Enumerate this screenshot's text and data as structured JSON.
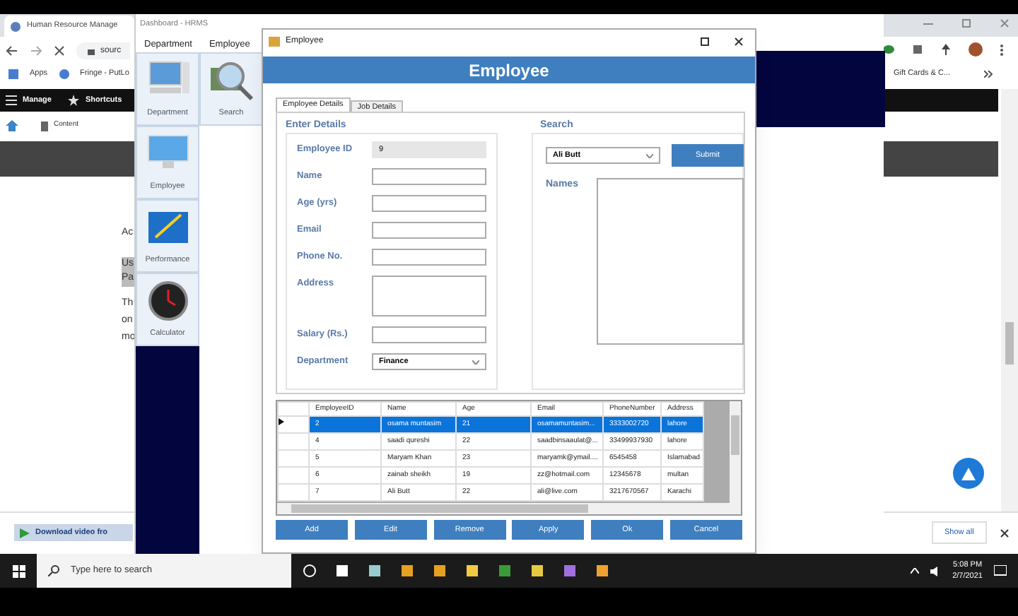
{
  "browser": {
    "tab_title": "Human Resource Manage",
    "address": "sourc",
    "bookmarks": [
      "Apps",
      "Fringe - PutLo",
      "Gift Cards & C..."
    ],
    "toolbar": [
      "Manage",
      "Shortcuts"
    ],
    "breadcrumb": "Content",
    "page_fragments": [
      "Ac",
      "Us",
      "Pa",
      "Th",
      "on",
      "mo"
    ],
    "download": "Download video fro",
    "show_all": "Show all"
  },
  "dashboard": {
    "title": "Dashboard - HRMS",
    "menu": [
      "Department",
      "Employee"
    ],
    "tiles": [
      {
        "kind": "computer",
        "label": "Department"
      },
      {
        "kind": "search",
        "label": "Search"
      },
      {
        "kind": "monitor",
        "label": "Employee"
      },
      {
        "kind": "chart",
        "label": "Performance"
      },
      {
        "kind": "clock",
        "label": "Calculator"
      }
    ]
  },
  "dialog": {
    "title": "Employee",
    "header": "Employee",
    "tabs": [
      {
        "label": "Employee Details",
        "selected": true
      },
      {
        "label": "Job Details",
        "selected": false
      }
    ],
    "details_title": "Enter Details",
    "fields": [
      {
        "kind": "readonly",
        "label": "Employee ID",
        "value": "9"
      },
      {
        "kind": "text",
        "label": "Name"
      },
      {
        "kind": "text",
        "label": "Age (yrs)"
      },
      {
        "kind": "text",
        "label": "Email"
      },
      {
        "kind": "text",
        "label": "Phone No."
      },
      {
        "kind": "area",
        "label": "Address"
      },
      {
        "kind": "text",
        "label": "Salary (Rs.)"
      },
      {
        "kind": "select",
        "label": "Department",
        "value": "Finance"
      }
    ],
    "search_title": "Search",
    "search_value": "Ali Butt",
    "submit": "Submit",
    "names_label": "Names",
    "table": {
      "columns": [
        "EmployeeID",
        "Name",
        "Age",
        "Email",
        "PhoneNumber",
        "Address"
      ],
      "rows": [
        {
          "cells": [
            "2",
            "osama muntasim",
            "21",
            "osamamuntasim...",
            "3333002720",
            "lahore"
          ],
          "selected": true
        },
        {
          "cells": [
            "4",
            "saadi qureshi",
            "22",
            "saadbinsaaulat@...",
            "33499937930",
            "lahore"
          ],
          "selected": false
        },
        {
          "cells": [
            "5",
            "Maryam Khan",
            "23",
            "maryamk@ymail....",
            "6545458",
            "Islamabad"
          ],
          "selected": false
        },
        {
          "cells": [
            "6",
            "zainab sheikh",
            "19",
            "zz@hotmail.com",
            "12345678",
            "multan"
          ],
          "selected": false
        },
        {
          "cells": [
            "7",
            "Ali Butt",
            "22",
            "ali@live.com",
            "3217670567",
            "Karachi"
          ],
          "selected": false
        }
      ]
    },
    "buttons": [
      "Add",
      "Edit",
      "Remove",
      "Apply",
      "Ok",
      "Cancel"
    ]
  },
  "taskbar": {
    "search_placeholder": "Type here to search",
    "time": "5:08 PM",
    "date": "2/7/2021"
  }
}
